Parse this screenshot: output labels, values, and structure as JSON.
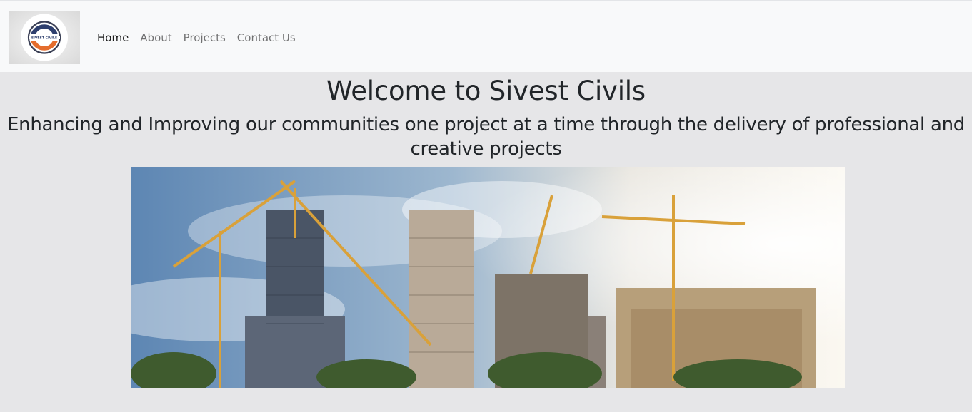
{
  "navbar": {
    "logo": {
      "icon": "company-logo",
      "text": "SIVEST CIVILS"
    },
    "links": [
      {
        "label": "Home",
        "active": true
      },
      {
        "label": "About",
        "active": false
      },
      {
        "label": "Projects",
        "active": false
      },
      {
        "label": "Contact Us",
        "active": false
      }
    ]
  },
  "hero": {
    "title": "Welcome to Sivest Civils",
    "subtitle": "Enhancing and Improving our communities one project at a time through the delivery of professional and creative projects",
    "image": "construction-cranes-photo"
  },
  "colors": {
    "page_background": "#e6e6e8",
    "navbar_background": "#f8f9fa",
    "logo_orange": "#e46d2d",
    "logo_navy": "#2e3f6e"
  }
}
